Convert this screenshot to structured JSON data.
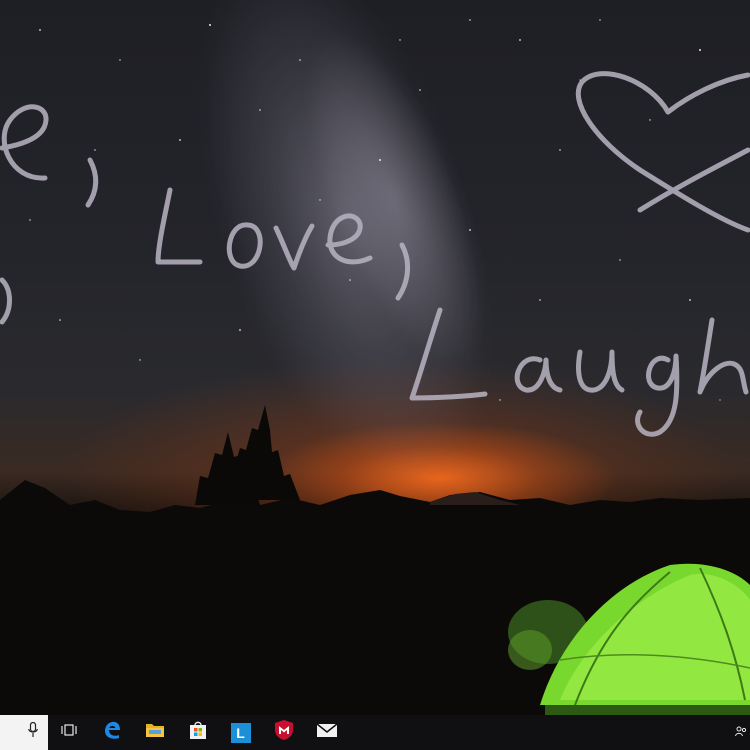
{
  "wallpaper": {
    "handwriting": [
      "e,",
      "Love,",
      "Laugh"
    ]
  },
  "taskbar": {
    "search": {
      "icon": "microphone-icon"
    },
    "buttons": [
      {
        "name": "task-view-button",
        "icon": "task-view-icon"
      },
      {
        "name": "edge-button",
        "icon": "edge-icon"
      },
      {
        "name": "file-explorer-button",
        "icon": "folder-icon"
      },
      {
        "name": "store-button",
        "icon": "store-bag-icon"
      },
      {
        "name": "l-app-button",
        "icon": "l-app-icon",
        "label": "L"
      },
      {
        "name": "mcafee-button",
        "icon": "mcafee-shield-icon"
      },
      {
        "name": "mail-button",
        "icon": "mail-icon"
      }
    ],
    "tray": {
      "icon": "people-icon"
    }
  },
  "colors": {
    "taskbar": "#101012",
    "edge": "#1e88e5",
    "folder": "#f5c542",
    "l_app": "#1d8fd6",
    "mcafee": "#c8102e",
    "tent": "#8bea3a"
  }
}
